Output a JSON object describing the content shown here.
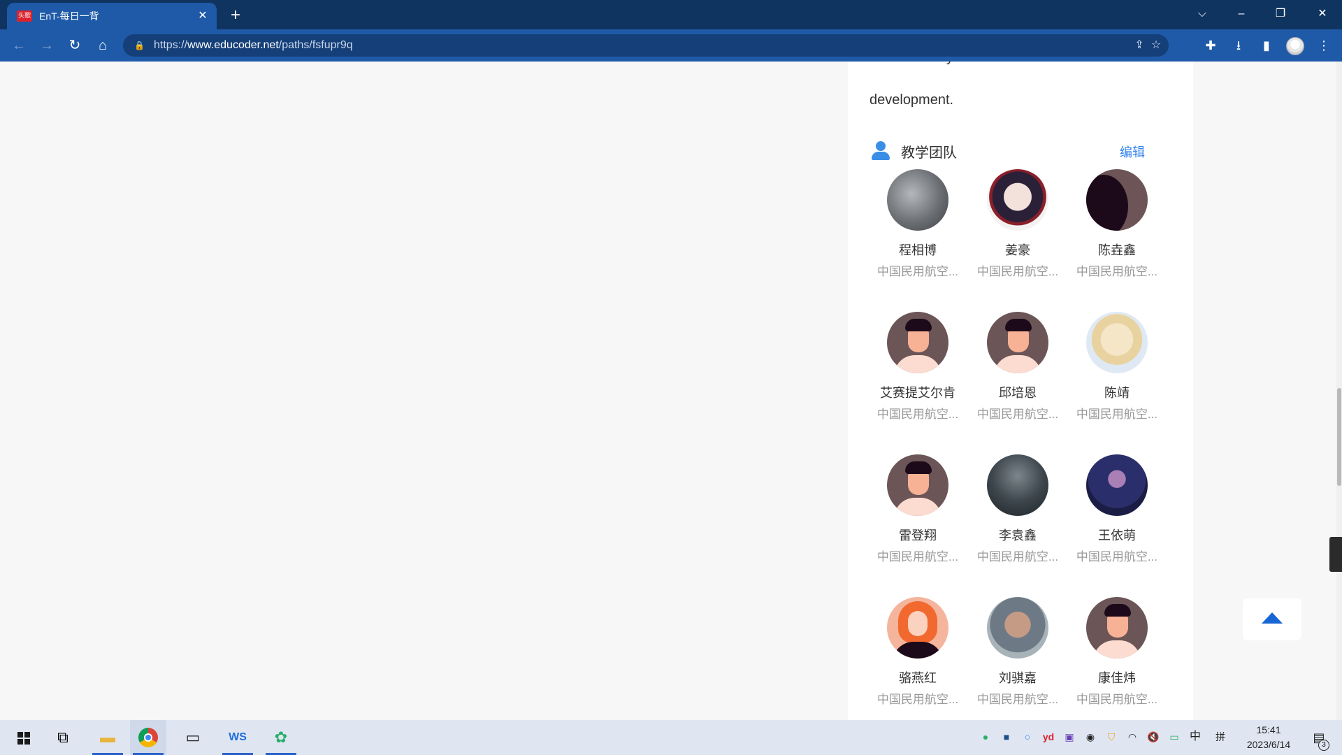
{
  "browser": {
    "tab": {
      "favicon_text": "头歌",
      "title": "EnT-每日一背",
      "close_icon": "close-icon"
    },
    "new_tab_icon": "plus-icon",
    "window_controls": [
      "chevron-down-icon",
      "minimize-icon",
      "restore-icon",
      "close-icon"
    ],
    "url": {
      "scheme": "https://",
      "host": "www.educoder.net",
      "path": "/paths/fsfupr9q"
    }
  },
  "page": {
    "cut_text": "tremendously to economic and social",
    "description_tail": "development.",
    "team": {
      "title": "教学团队",
      "edit_label": "编辑",
      "members": [
        {
          "name": "程相博",
          "org": "中国民用航空..."
        },
        {
          "name": "姜豪",
          "org": "中国民用航空..."
        },
        {
          "name": "陈垚鑫",
          "org": "中国民用航空..."
        },
        {
          "name": "艾赛提艾尔肯",
          "org": "中国民用航空..."
        },
        {
          "name": "邱培恩",
          "org": "中国民用航空..."
        },
        {
          "name": "陈靖",
          "org": "中国民用航空..."
        },
        {
          "name": "雷登翔",
          "org": "中国民用航空..."
        },
        {
          "name": "李袁鑫",
          "org": "中国民用航空..."
        },
        {
          "name": "王依萌",
          "org": "中国民用航空..."
        },
        {
          "name": "骆燕红",
          "org": "中国民用航空..."
        },
        {
          "name": "刘骐嘉",
          "org": "中国民用航空..."
        },
        {
          "name": "康佳炜",
          "org": "中国民用航空..."
        }
      ]
    }
  },
  "taskbar": {
    "clock_time": "15:41",
    "clock_date": "2023/6/14",
    "ime_lang": "中",
    "ime_mode": "拼",
    "notification_count": "3"
  },
  "colors": {
    "titlebar": "#0f3460",
    "toolbar": "#1f5aa8",
    "accent": "#2f80ed",
    "back_to_top": "#1766d6"
  }
}
